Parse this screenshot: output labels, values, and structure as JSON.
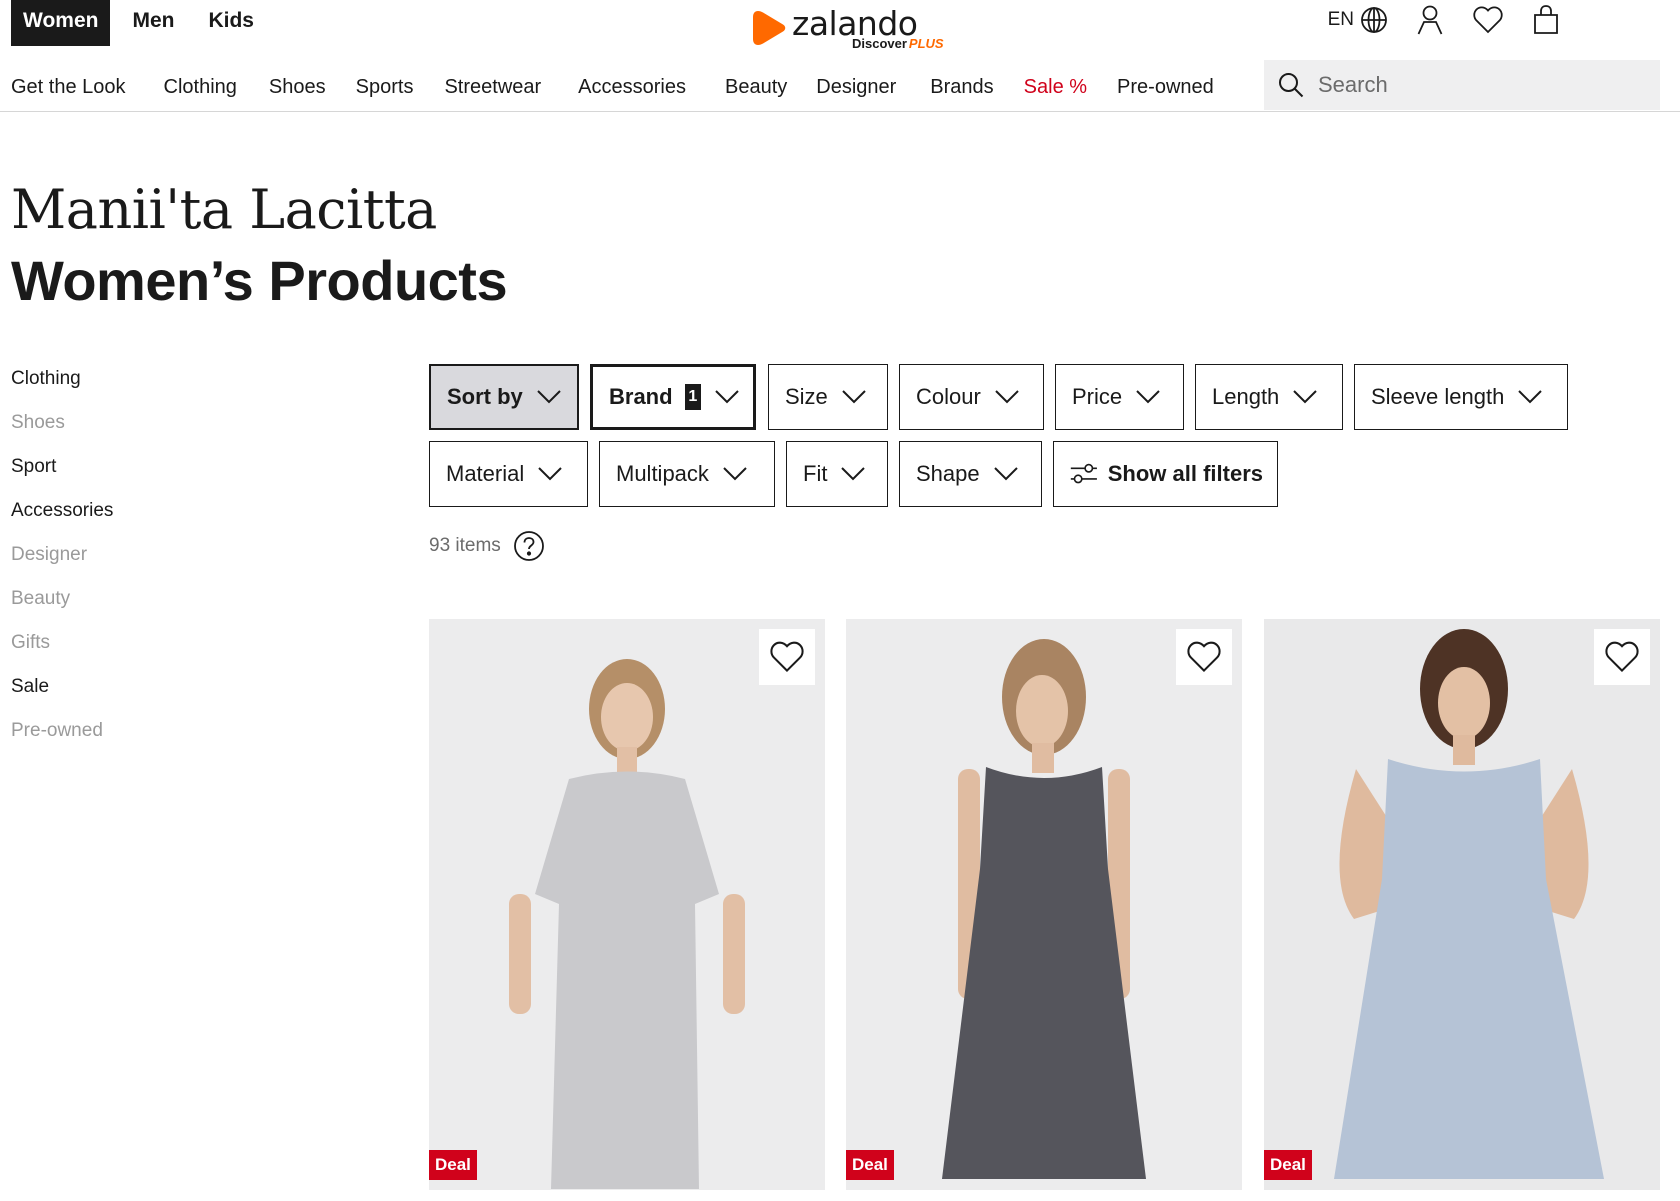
{
  "header": {
    "gender_tabs": [
      "Women",
      "Men",
      "Kids"
    ],
    "logo_text": "zalando",
    "logo_sub": "Discover",
    "logo_plus": "PLUS",
    "language": "EN",
    "icons": [
      "globe-icon",
      "user-icon",
      "heart-icon",
      "bag-icon"
    ],
    "nav": [
      "Get the Look",
      "Clothing",
      "Shoes",
      "Sports",
      "Streetwear",
      "Accessories",
      "Beauty",
      "Designer",
      "Brands",
      "Sale %",
      "Pre-owned"
    ],
    "search_placeholder": "Search"
  },
  "titles": {
    "brand": "Manii'ta Lacitta",
    "page": "Women’s Products"
  },
  "sidebar": {
    "items": [
      {
        "label": "Clothing",
        "muted": false
      },
      {
        "label": "Shoes",
        "muted": true
      },
      {
        "label": "Sport",
        "muted": false
      },
      {
        "label": "Accessories",
        "muted": false
      },
      {
        "label": "Designer",
        "muted": true
      },
      {
        "label": "Beauty",
        "muted": true
      },
      {
        "label": "Gifts",
        "muted": true
      },
      {
        "label": "Sale",
        "muted": false
      },
      {
        "label": "Pre-owned",
        "muted": true
      }
    ]
  },
  "filters": {
    "sort": "Sort by",
    "brand": "Brand",
    "brand_count": "1",
    "size": "Size",
    "colour": "Colour",
    "price": "Price",
    "length": "Length",
    "sleeve": "Sleeve length",
    "material": "Material",
    "multipack": "Multipack",
    "fit": "Fit",
    "shape": "Shape",
    "all": "Show all filters"
  },
  "results": {
    "count": "93 items"
  },
  "products": [
    {
      "badge": "Deal",
      "dress_color": "#c9c9cc",
      "sleeves": "short"
    },
    {
      "badge": "Deal",
      "dress_color": "#55555c",
      "sleeves": "none"
    },
    {
      "badge": "Deal",
      "dress_color": "#b5c3d6",
      "sleeves": "none"
    }
  ],
  "colors": {
    "accent_orange": "#ff6900",
    "sale_red": "#d0021b",
    "text": "#1a1a1a",
    "muted": "#9a9a9a"
  }
}
